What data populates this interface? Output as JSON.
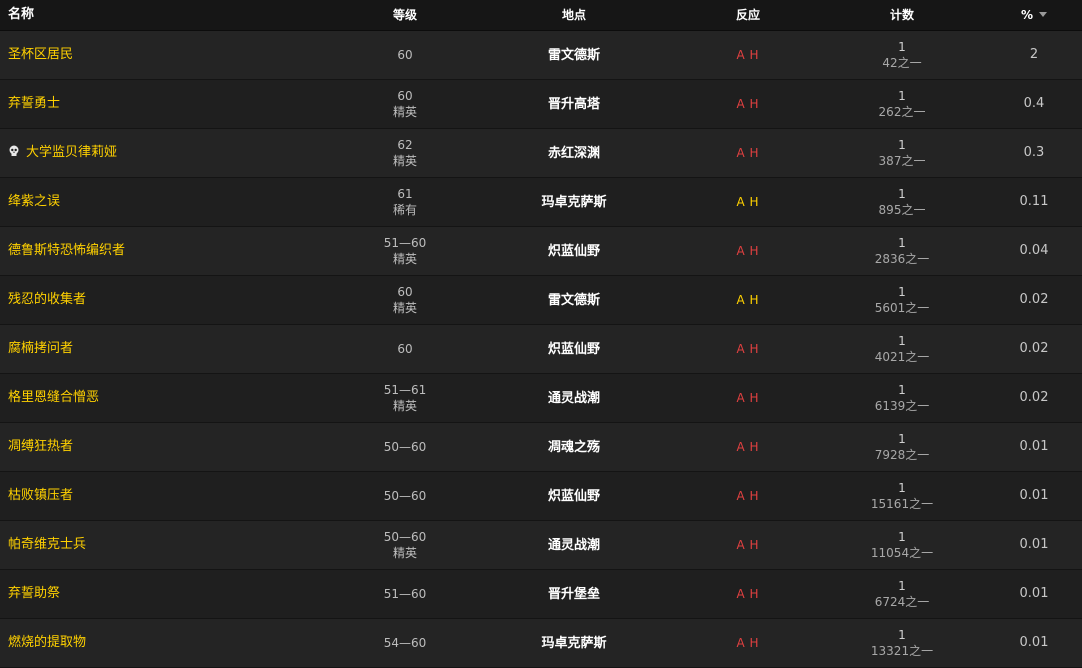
{
  "columns": {
    "name": "名称",
    "level": "等级",
    "location": "地点",
    "reaction": "反应",
    "count": "计数",
    "percent": "%"
  },
  "colors": {
    "name": "#ffd100",
    "hostile": "#e04040",
    "neutral": "#ffd100"
  },
  "rows": [
    {
      "name": "圣杯区居民",
      "icon": "",
      "level": "60",
      "level_sub": "",
      "location": "雷文德斯",
      "react_a": "A",
      "react_h": "H",
      "reaction": "hostile",
      "count": "1",
      "count_sub": "42之一",
      "percent": "2"
    },
    {
      "name": "弃誓勇士",
      "icon": "",
      "level": "60",
      "level_sub": "精英",
      "location": "晋升高塔",
      "react_a": "A",
      "react_h": "H",
      "reaction": "hostile",
      "count": "1",
      "count_sub": "262之一",
      "percent": "0.4"
    },
    {
      "name": "大学监贝律莉娅",
      "icon": "skull-icon",
      "level": "62",
      "level_sub": "精英",
      "location": "赤红深渊",
      "react_a": "A",
      "react_h": "H",
      "reaction": "hostile",
      "count": "1",
      "count_sub": "387之一",
      "percent": "0.3"
    },
    {
      "name": "绛紫之误",
      "icon": "",
      "level": "61",
      "level_sub": "稀有",
      "location": "玛卓克萨斯",
      "react_a": "A",
      "react_h": "H",
      "reaction": "neutral",
      "count": "1",
      "count_sub": "895之一",
      "percent": "0.11"
    },
    {
      "name": "德鲁斯特恐怖编织者",
      "icon": "",
      "level": "51—60",
      "level_sub": "精英",
      "location": "炽蓝仙野",
      "react_a": "A",
      "react_h": "H",
      "reaction": "hostile",
      "count": "1",
      "count_sub": "2836之一",
      "percent": "0.04"
    },
    {
      "name": "残忍的收集者",
      "icon": "",
      "level": "60",
      "level_sub": "精英",
      "location": "雷文德斯",
      "react_a": "A",
      "react_h": "H",
      "reaction": "neutral",
      "count": "1",
      "count_sub": "5601之一",
      "percent": "0.02"
    },
    {
      "name": "腐楠拷问者",
      "icon": "",
      "level": "60",
      "level_sub": "",
      "location": "炽蓝仙野",
      "react_a": "A",
      "react_h": "H",
      "reaction": "hostile",
      "count": "1",
      "count_sub": "4021之一",
      "percent": "0.02"
    },
    {
      "name": "格里恩缝合憎恶",
      "icon": "",
      "level": "51—61",
      "level_sub": "精英",
      "location": "通灵战潮",
      "react_a": "A",
      "react_h": "H",
      "reaction": "hostile",
      "count": "1",
      "count_sub": "6139之一",
      "percent": "0.02"
    },
    {
      "name": "凋缚狂热者",
      "icon": "",
      "level": "50—60",
      "level_sub": "",
      "location": "凋魂之殇",
      "react_a": "A",
      "react_h": "H",
      "reaction": "hostile",
      "count": "1",
      "count_sub": "7928之一",
      "percent": "0.01"
    },
    {
      "name": "枯败镇压者",
      "icon": "",
      "level": "50—60",
      "level_sub": "",
      "location": "炽蓝仙野",
      "react_a": "A",
      "react_h": "H",
      "reaction": "hostile",
      "count": "1",
      "count_sub": "15161之一",
      "percent": "0.01"
    },
    {
      "name": "帕奇维克士兵",
      "icon": "",
      "level": "50—60",
      "level_sub": "精英",
      "location": "通灵战潮",
      "react_a": "A",
      "react_h": "H",
      "reaction": "hostile",
      "count": "1",
      "count_sub": "11054之一",
      "percent": "0.01"
    },
    {
      "name": "弃誓助祭",
      "icon": "",
      "level": "51—60",
      "level_sub": "",
      "location": "晋升堡垒",
      "react_a": "A",
      "react_h": "H",
      "reaction": "hostile",
      "count": "1",
      "count_sub": "6724之一",
      "percent": "0.01"
    },
    {
      "name": "燃烧的提取物",
      "icon": "",
      "level": "54—60",
      "level_sub": "",
      "location": "玛卓克萨斯",
      "react_a": "A",
      "react_h": "H",
      "reaction": "hostile",
      "count": "1",
      "count_sub": "13321之一",
      "percent": "0.01"
    }
  ]
}
